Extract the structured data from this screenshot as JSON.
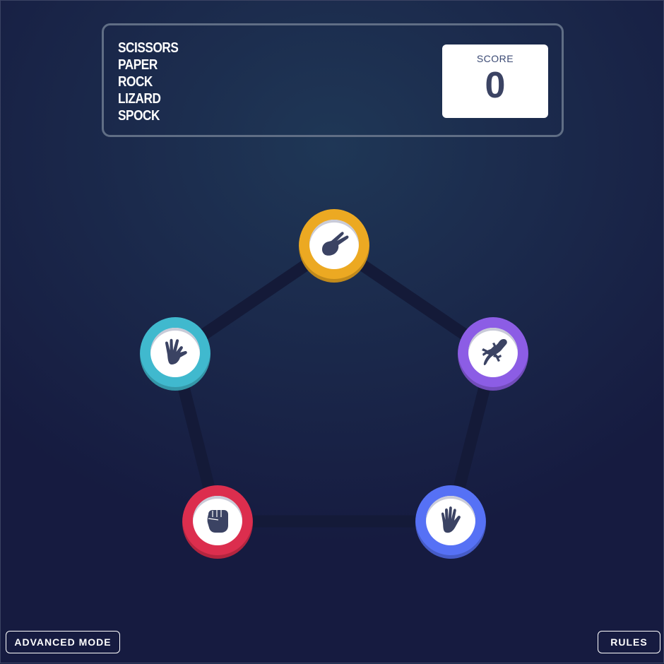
{
  "header": {
    "names": [
      "SCISSORS",
      "PAPER",
      "ROCK",
      "LIZARD",
      "SPOCK"
    ],
    "score_label": "SCORE",
    "score_value": "0"
  },
  "tokens": [
    {
      "id": "scissors",
      "icon": "scissors-hand-icon",
      "color": "#eca922"
    },
    {
      "id": "lizard",
      "icon": "lizard-icon",
      "color": "#8c5de5"
    },
    {
      "id": "paper",
      "icon": "paper-hand-icon",
      "color": "#5671f5"
    },
    {
      "id": "rock",
      "icon": "rock-fist-icon",
      "color": "#dc2e4e"
    },
    {
      "id": "spock",
      "icon": "spock-hand-icon",
      "color": "#40b9ce"
    }
  ],
  "colors": {
    "pentagon": "#141a38",
    "icon_fill": "#3b4363",
    "score_text": "#3b4363"
  },
  "footer": {
    "advanced_label": "ADVANCED MODE",
    "rules_label": "RULES"
  }
}
